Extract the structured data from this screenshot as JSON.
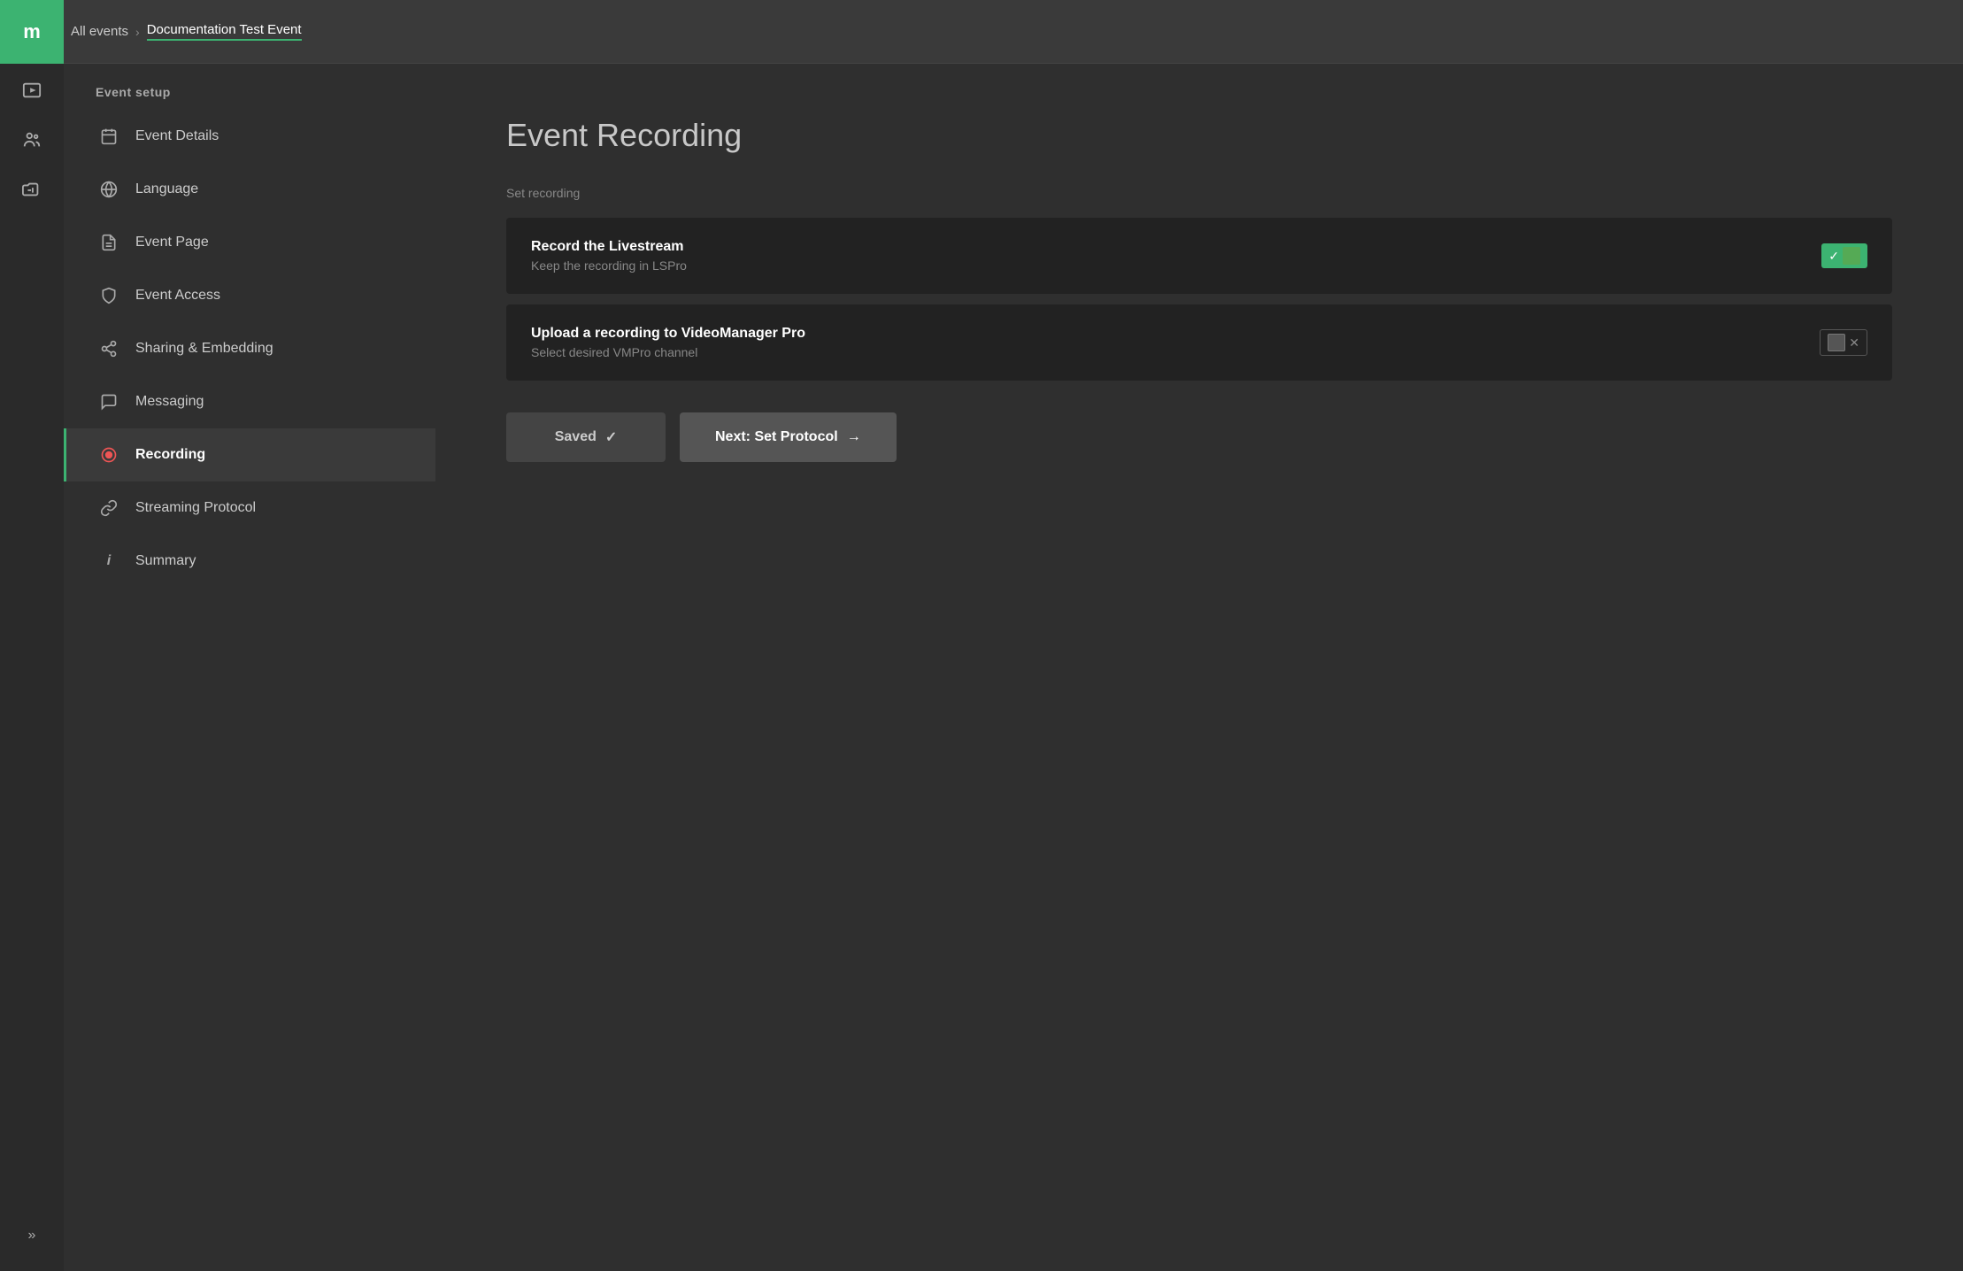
{
  "brand": {
    "logo_letter": "m"
  },
  "topbar": {
    "breadcrumb_link": "All events",
    "separator": "›",
    "current_page": "Documentation Test Event"
  },
  "sidebar": {
    "section_title": "Event setup",
    "items": [
      {
        "id": "event-details",
        "label": "Event Details",
        "icon": "calendar"
      },
      {
        "id": "language",
        "label": "Language",
        "icon": "globe"
      },
      {
        "id": "event-page",
        "label": "Event Page",
        "icon": "file"
      },
      {
        "id": "event-access",
        "label": "Event Access",
        "icon": "shield"
      },
      {
        "id": "sharing-embedding",
        "label": "Sharing & Embedding",
        "icon": "share"
      },
      {
        "id": "messaging",
        "label": "Messaging",
        "icon": "chat"
      },
      {
        "id": "recording",
        "label": "Recording",
        "icon": "record",
        "active": true
      },
      {
        "id": "streaming-protocol",
        "label": "Streaming Protocol",
        "icon": "link"
      },
      {
        "id": "summary",
        "label": "Summary",
        "icon": "info"
      }
    ]
  },
  "main": {
    "page_title": "Event Recording",
    "section_label": "Set recording",
    "cards": [
      {
        "id": "record-livestream",
        "title": "Record the Livestream",
        "subtitle": "Keep the recording in LSPro",
        "toggle_state": "on",
        "toggle_label": "✓"
      },
      {
        "id": "upload-recording",
        "title": "Upload a recording to VideoManager Pro",
        "subtitle": "Select desired VMPro channel",
        "toggle_state": "off",
        "toggle_label": "✕"
      }
    ],
    "buttons": {
      "saved": "Saved",
      "saved_icon": "✓",
      "next": "Next: Set Protocol",
      "next_icon": "→"
    }
  }
}
